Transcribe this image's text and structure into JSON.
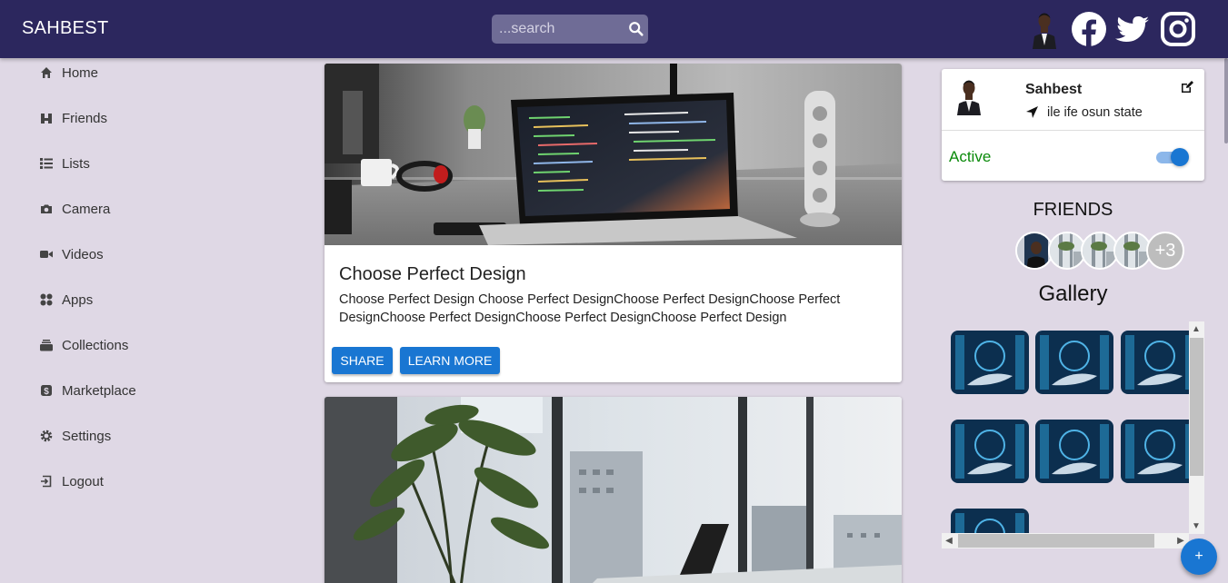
{
  "header": {
    "brand": "SAHBEST",
    "search_placeholder": "...search"
  },
  "sidebar": {
    "items": [
      {
        "label": "Home",
        "icon": "home-icon"
      },
      {
        "label": "Friends",
        "icon": "friends-icon"
      },
      {
        "label": "Lists",
        "icon": "list-icon"
      },
      {
        "label": "Camera",
        "icon": "camera-icon"
      },
      {
        "label": "Videos",
        "icon": "video-icon"
      },
      {
        "label": "Apps",
        "icon": "apps-icon"
      },
      {
        "label": "Collections",
        "icon": "collections-icon"
      },
      {
        "label": "Marketplace",
        "icon": "marketplace-icon"
      },
      {
        "label": "Settings",
        "icon": "gear-icon"
      },
      {
        "label": "Logout",
        "icon": "logout-icon"
      }
    ]
  },
  "posts": [
    {
      "title": "Choose Perfect Design",
      "text": "Choose Perfect Design Choose Perfect DesignChoose Perfect DesignChoose Perfect DesignChoose Perfect DesignChoose Perfect DesignChoose Perfect Design",
      "share_label": "SHARE",
      "learn_more_label": "LEARN MORE"
    }
  ],
  "profile": {
    "name": "Sahbest",
    "location": "ile ife osun state",
    "status": "Active",
    "active": true
  },
  "friends": {
    "title": "FRIENDS",
    "more_count": "+3"
  },
  "gallery": {
    "title": "Gallery"
  },
  "fab_label": "+",
  "colors": {
    "header": "#2c275e",
    "page_bg": "#dfd8e5",
    "primary": "#1976d2",
    "active_status": "#0a8a0a"
  }
}
